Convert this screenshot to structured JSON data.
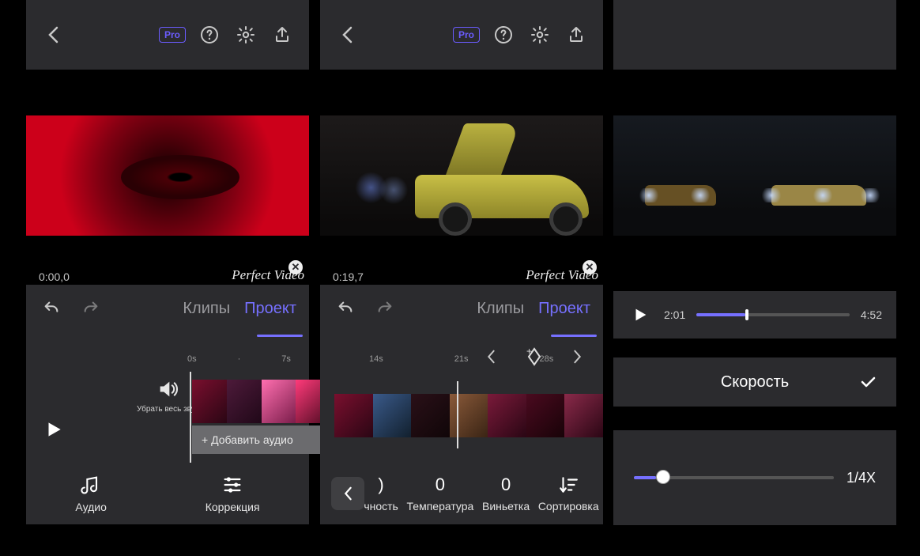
{
  "common": {
    "pro": "Pro",
    "watermark": "Perfect Video",
    "tabs": {
      "clips": "Клипы",
      "project": "Проект"
    }
  },
  "panel1": {
    "timestamp": "0:00,0",
    "timeline": {
      "t0": "0s",
      "t1": "7s"
    },
    "mute_all": "Убрать весь звук",
    "add_audio": "+ Добавить аудио",
    "tools": {
      "audio": "Аудио",
      "correction": "Коррекция"
    }
  },
  "panel2": {
    "timestamp": "0:19,7",
    "timeline": {
      "t0": "14s",
      "t1": "21s",
      "t2": "28s"
    },
    "tools": {
      "b_partial": "чность",
      "b_val": ")",
      "temperature": "Температура",
      "temperature_val": "0",
      "vignette": "Виньетка",
      "vignette_val": "0",
      "sort": "Сортировка"
    }
  },
  "panel3": {
    "play": {
      "current": "2:01",
      "total": "4:52",
      "progress_pct": 32
    },
    "speed": {
      "title": "Скорость",
      "value": "1/4X",
      "slider_pct": 11
    }
  }
}
